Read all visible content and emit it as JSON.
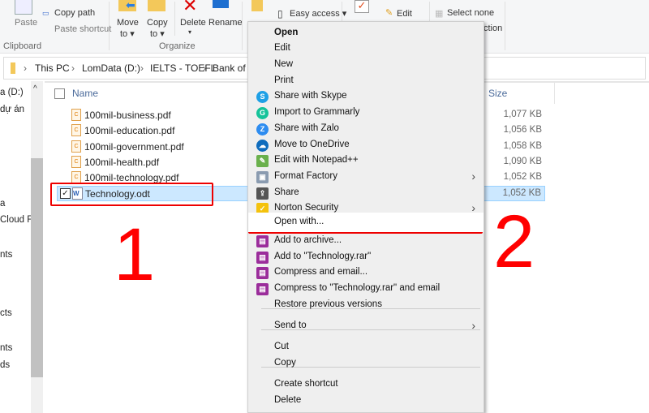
{
  "ribbon": {
    "paste": "Paste",
    "copy_path": "Copy path",
    "paste_shortcut": "Paste shortcut",
    "clipboard_group": "Clipboard",
    "move_to": "Move",
    "move_to2": "to ▾",
    "copy_to": "Copy",
    "copy_to2": "to ▾",
    "delete": "Delete",
    "delete2": "▾",
    "rename": "Rename",
    "organize_group": "Organize",
    "easy_access": "Easy access ▾",
    "edit": "Edit",
    "select_none": "Select none",
    "invert_selection_partial": "ction"
  },
  "address": {
    "crumbs": [
      "This PC",
      "LomData (D:)",
      "IELTS - TOEFL",
      "Bank of id"
    ]
  },
  "nav": {
    "items": [
      "a (D:)",
      "dự án",
      "a",
      "Cloud Fi",
      "nts",
      "cts",
      "nts",
      "ds"
    ]
  },
  "columns": {
    "name": "Name",
    "size": "Size"
  },
  "files": [
    {
      "name": "100mil-business.pdf",
      "size": "1,077 KB"
    },
    {
      "name": "100mil-education.pdf",
      "size": "1,056 KB"
    },
    {
      "name": "100mil-government.pdf",
      "size": "1,058 KB"
    },
    {
      "name": "100mil-health.pdf",
      "size": "1,090 KB"
    },
    {
      "name": "100mil-technology.pdf",
      "size": "1,052 KB"
    },
    {
      "name": "Technology.odt",
      "size": "1,052 KB",
      "selected": true
    }
  ],
  "menu": {
    "items": [
      "Open",
      "Edit",
      "New",
      "Print",
      "Share with Skype",
      "Import to Grammarly",
      "Share with Zalo",
      "Move to OneDrive",
      "Edit with Notepad++",
      "Format Factory",
      "Share",
      "Norton Security",
      "Open with...",
      "Add to archive...",
      "Add to \"Technology.rar\"",
      "Compress and email...",
      "Compress to \"Technology.rar\" and email",
      "Restore previous versions",
      "Send to",
      "Cut",
      "Copy",
      "Create shortcut",
      "Delete"
    ]
  },
  "annotations": {
    "step1": "1",
    "step2": "2"
  },
  "colors": {
    "annotation": "#ff0000",
    "selection": "#cce8ff"
  }
}
